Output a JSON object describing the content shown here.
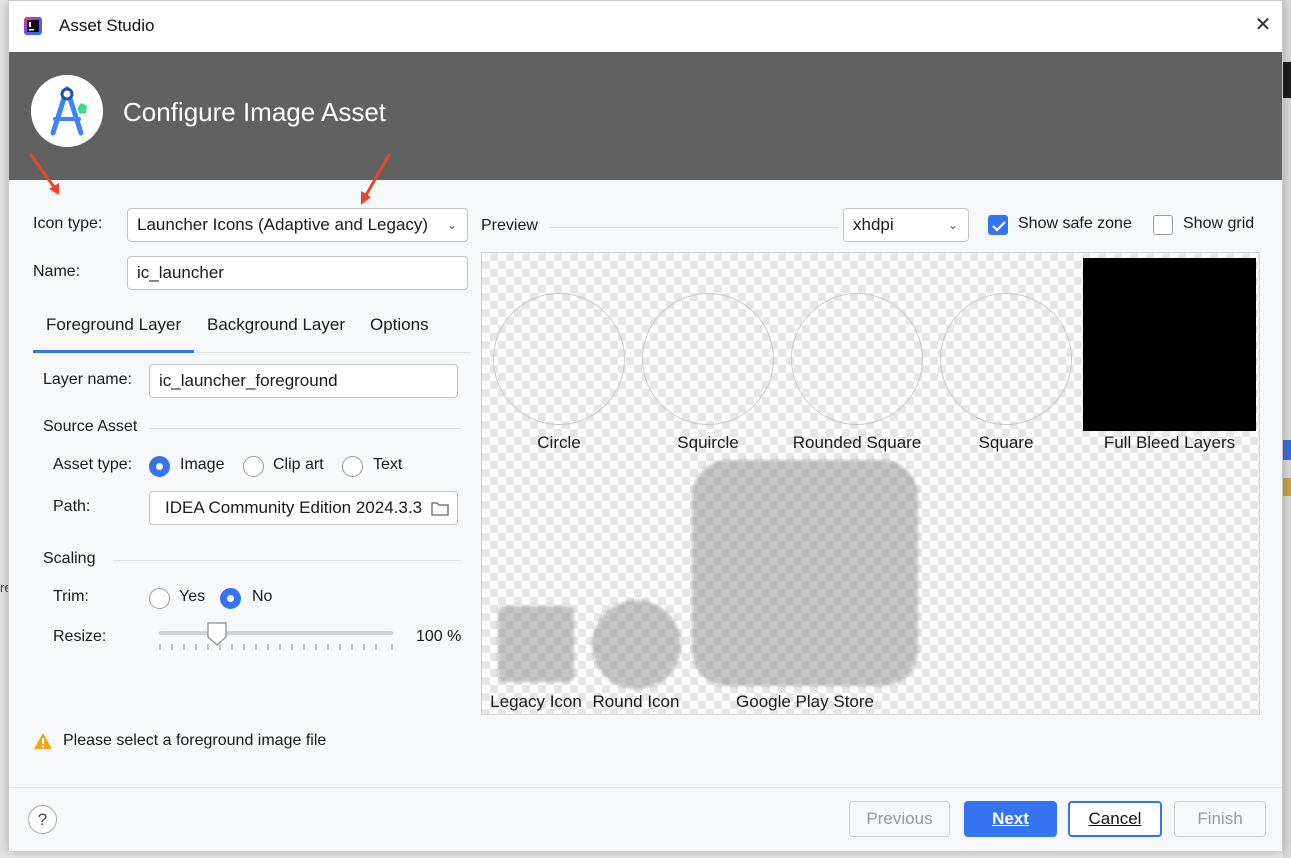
{
  "window": {
    "title": "Asset Studio",
    "close_glyph": "✕"
  },
  "banner": {
    "title": "Configure Image Asset"
  },
  "form": {
    "icon_type_label": "Icon type:",
    "icon_type_value": "Launcher Icons (Adaptive and Legacy)",
    "name_label": "Name:",
    "name_value": "ic_launcher"
  },
  "tabs": [
    {
      "label": "Foreground Layer",
      "selected": true
    },
    {
      "label": "Background Layer",
      "selected": false
    },
    {
      "label": "Options",
      "selected": false
    }
  ],
  "layer": {
    "layer_name_label": "Layer name:",
    "layer_name_value": "ic_launcher_foreground",
    "source_asset_heading": "Source Asset",
    "asset_type_label": "Asset type:",
    "asset_type_options": [
      "Image",
      "Clip art",
      "Text"
    ],
    "asset_type_selected": "Image",
    "path_label": "Path:",
    "path_value": "IDEA Community Edition 2024.3.3",
    "scaling_heading": "Scaling",
    "trim_label": "Trim:",
    "trim_options": [
      "Yes",
      "No"
    ],
    "trim_selected": "No",
    "resize_label": "Resize:",
    "resize_value": "100 %"
  },
  "preview": {
    "label": "Preview",
    "density": "xhdpi",
    "show_safe_zone": {
      "label": "Show safe zone",
      "checked": true
    },
    "show_grid": {
      "label": "Show grid",
      "checked": false
    },
    "captions": [
      "Circle",
      "Squircle",
      "Rounded Square",
      "Square",
      "Full Bleed Layers",
      "Legacy Icon",
      "Round Icon",
      "Google Play Store"
    ]
  },
  "warning": {
    "text": "Please select a foreground image file",
    "icon": "warning-triangle-icon",
    "color": "#f2a516"
  },
  "footer": {
    "help": "?",
    "previous": "Previous",
    "next": "Next",
    "cancel": "Cancel",
    "finish": "Finish"
  },
  "colors": {
    "accent": "#3574f0",
    "banner": "#616161",
    "annotation_arrow": "#e5472b"
  },
  "background": {
    "edge_text": "re"
  }
}
